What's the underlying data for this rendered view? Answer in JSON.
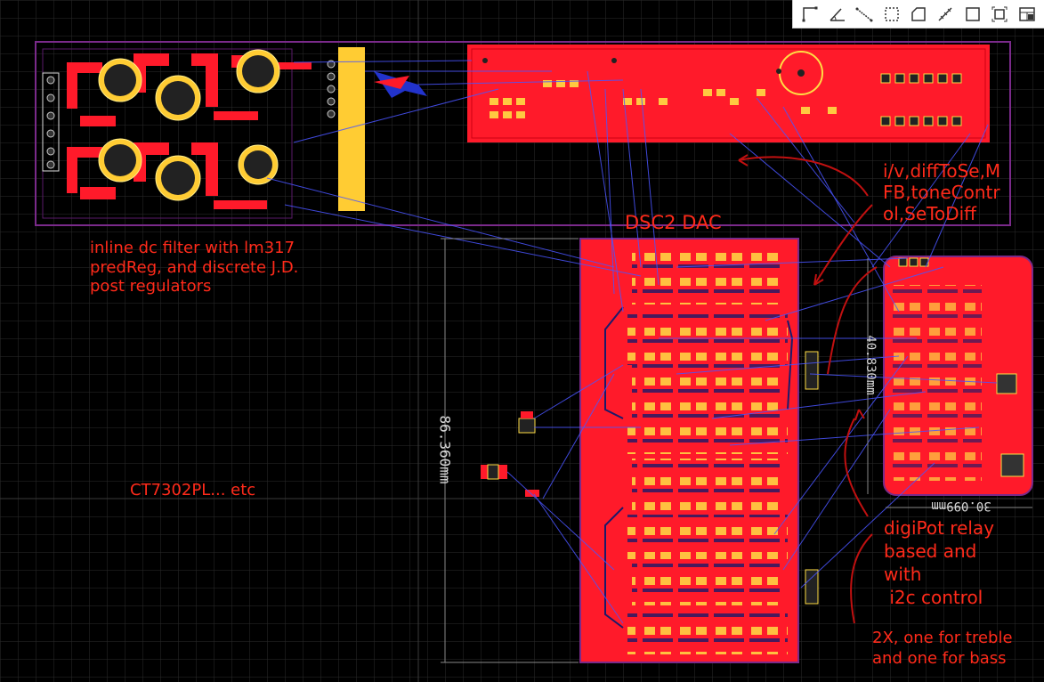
{
  "toolbar": {
    "tools": [
      {
        "icon": "wire-route-icon"
      },
      {
        "icon": "angle-measure-icon"
      },
      {
        "icon": "polyline-icon"
      },
      {
        "icon": "dashed-selection-icon"
      },
      {
        "icon": "polygon-region-icon"
      },
      {
        "icon": "diagonal-measure-icon"
      },
      {
        "icon": "rectangle-icon"
      },
      {
        "icon": "fit-selection-icon"
      },
      {
        "icon": "panel-layout-icon"
      }
    ]
  },
  "labels": {
    "dac_title": "DSC2 DAC",
    "power_note": "inline dc filter with lm317\npredReg, and discrete J.D.\npost regulators",
    "opamp_note": "i/v,diffToSe,M\nFB,toneContr\nol,SeToDiff",
    "ct_note": "CT7302PL... etc",
    "digipot_note": "digiPot relay\nbased and\nwith\n i2c control",
    "digipot_note2": "2X, one for treble\nand one for bass",
    "dim_vertical": "86.360mm",
    "dim_right": "30.099mm",
    "dim_right_vertical": "40.830mm"
  },
  "colors": {
    "copper": "#ff1a2a",
    "outline": "#7a2a8a",
    "silk": "#ffcc33",
    "ratsnest": "#4a55ff",
    "annotation": "#ff2a1a"
  }
}
